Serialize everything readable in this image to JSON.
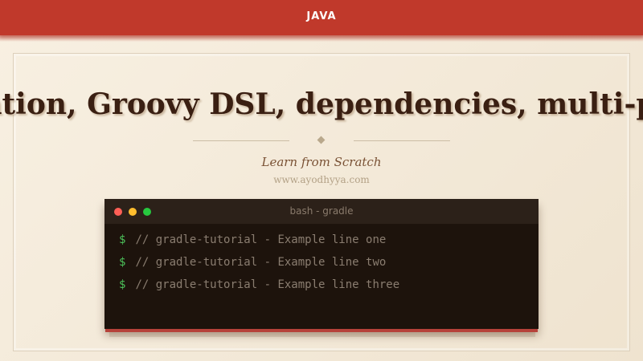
{
  "header": {
    "category": "JAVA"
  },
  "hero": {
    "headline": "Build automation, Groovy DSL, dependencies, multi-project builds",
    "subtitle": "Learn from Scratch",
    "site": "www.ayodhyya.com"
  },
  "terminal": {
    "title": "bash - gradle",
    "prompt_symbol": "$",
    "lines": [
      "// gradle-tutorial - Example line one",
      "// gradle-tutorial - Example line two",
      "// gradle-tutorial - Example line three"
    ]
  },
  "colors": {
    "accent": "#c0392b",
    "background": "#f6eddf",
    "terminal_bg": "#1d130c",
    "prompt_green": "#4cc15a"
  }
}
